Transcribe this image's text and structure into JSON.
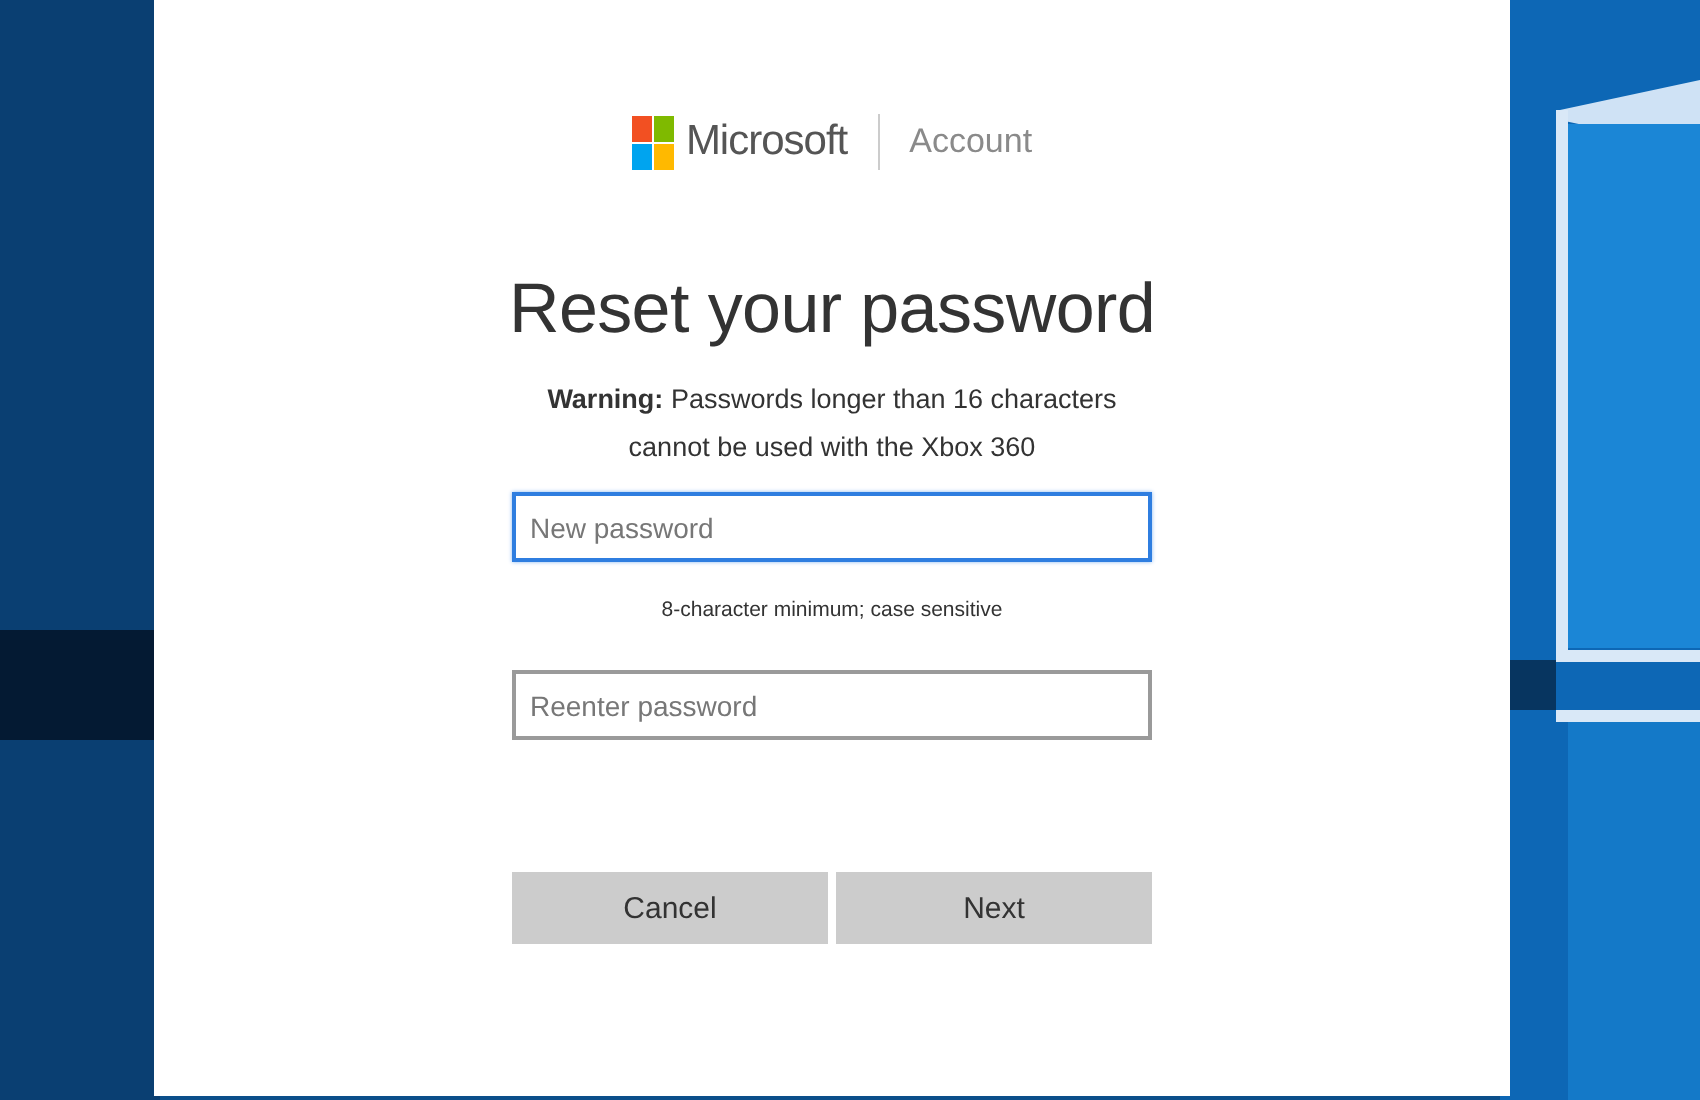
{
  "brand": {
    "name": "Microsoft",
    "section": "Account"
  },
  "title": "Reset your password",
  "warning": "**Warning:** Passwords longer than 16 characters cannot be used with the Xbox 360",
  "fields": [
    {
      "placeholder": "New password",
      "focused": true
    },
    {
      "placeholder": "Reenter password",
      "focused": false
    }
  ],
  "hint": "8-character minimum; case sensitive",
  "buttons": [
    "Cancel",
    "Next"
  ]
}
